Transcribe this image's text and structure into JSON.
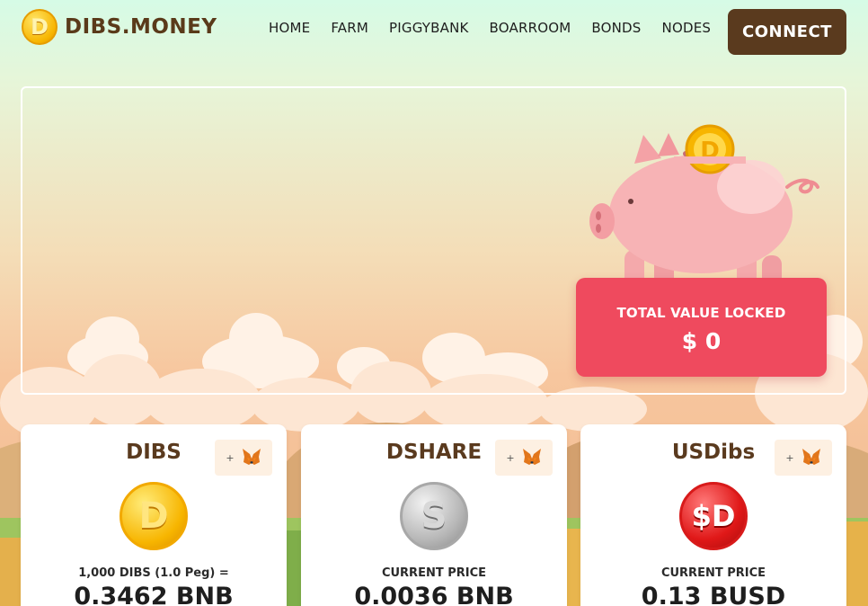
{
  "brand": {
    "name": "DIBS.MONEY",
    "logo_glyph": "D"
  },
  "nav": {
    "items": [
      "HOME",
      "FARM",
      "PIGGYBANK",
      "BOARROOM",
      "BONDS",
      "NODES"
    ]
  },
  "connect_label": "CONNECT",
  "hero": {
    "tvl_label": "TOTAL VALUE LOCKED",
    "tvl_value": "$ 0",
    "coin_glyph": "D"
  },
  "cards": [
    {
      "title": "DIBS",
      "add_plus": "+",
      "coin_glyph": "D",
      "price_label": "1,000 DIBS (1.0 Peg) =",
      "price_value": "0.3462 BNB"
    },
    {
      "title": "DSHARE",
      "add_plus": "+",
      "coin_glyph": "S",
      "price_label": "CURRENT PRICE",
      "price_value": "0.0036 BNB"
    },
    {
      "title": "USDibs",
      "add_plus": "+",
      "coin_glyph": "$D",
      "price_label": "CURRENT PRICE",
      "price_value": "0.13 BUSD"
    }
  ],
  "colors": {
    "brand_brown": "#5a3a1e",
    "tvl_red": "#ef4a5e",
    "coin_gold": "#f7b500",
    "coin_silver": "#b8b8b8",
    "coin_red": "#e01818"
  },
  "icons": {
    "wallet": "metamask-fox-icon",
    "piggybank": "piggy-bank-icon"
  }
}
